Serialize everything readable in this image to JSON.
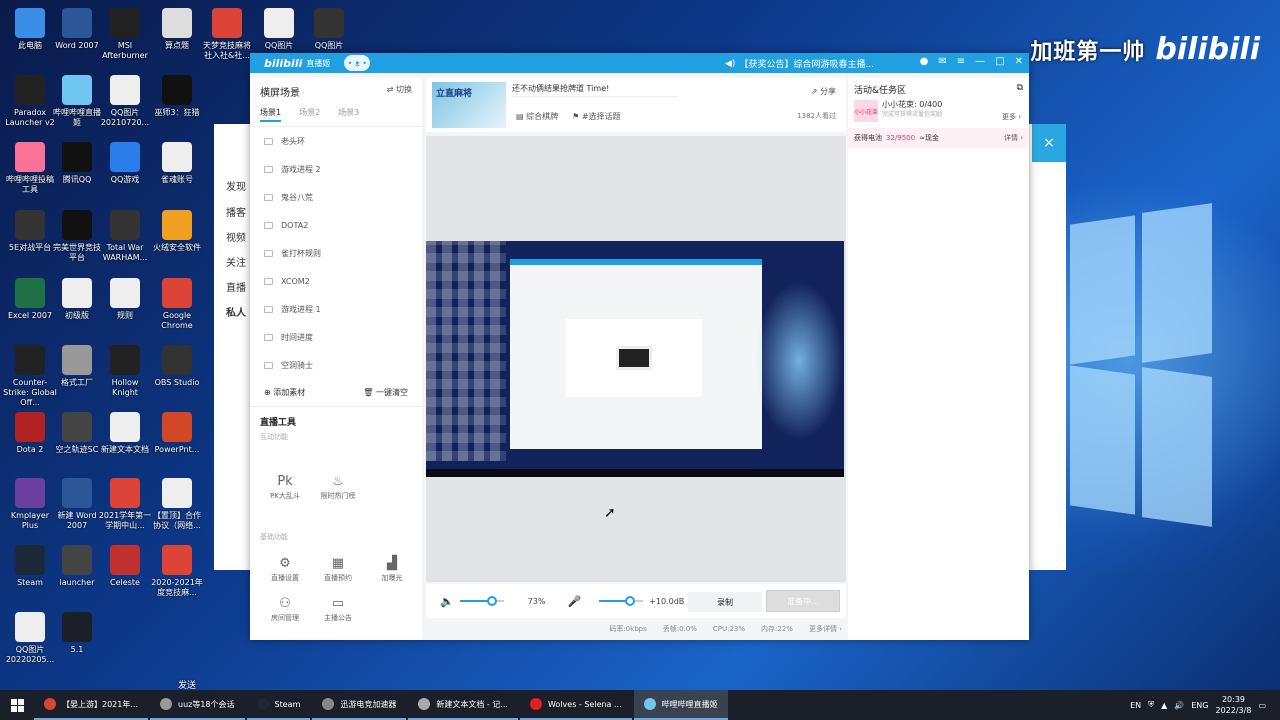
{
  "watermark": {
    "text": "加班第一帅",
    "logo": "bilibili"
  },
  "desktop_icons": [
    {
      "label": "此电脑",
      "color": "#3a8ee6"
    },
    {
      "label": "Word 2007",
      "color": "#2b5797"
    },
    {
      "label": "MSI Afterburner",
      "color": "#222"
    },
    {
      "label": "算点题",
      "color": "#ddd"
    },
    {
      "label": "天梦竞技麻将社入社&社...",
      "color": "#db4437"
    },
    {
      "label": "QQ图片",
      "color": "#eee"
    },
    {
      "label": "QQ图片",
      "color": "#333"
    },
    {
      "label": "Paradox Launcher v2",
      "color": "#222"
    },
    {
      "label": "哔哩哔哩直播姬",
      "color": "#6fc6f0"
    },
    {
      "label": "QQ图片 20210720...",
      "color": "#eee"
    },
    {
      "label": "巫师3：狂猎",
      "color": "#111"
    },
    {
      "label": "哔哩哔哩投稿工具",
      "color": "#fb7299"
    },
    {
      "label": "腾讯QQ",
      "color": "#111"
    },
    {
      "label": "QQ游戏",
      "color": "#2b7de9"
    },
    {
      "label": "雀魂账号",
      "color": "#eee"
    },
    {
      "label": "5E对战平台",
      "color": "#333"
    },
    {
      "label": "完美世界竞技平台",
      "color": "#111"
    },
    {
      "label": "Total War WARHAM...",
      "color": "#333"
    },
    {
      "label": "火绒安全软件",
      "color": "#f0a020"
    },
    {
      "label": "Excel 2007",
      "color": "#1e7145"
    },
    {
      "label": "初级版",
      "color": "#eee"
    },
    {
      "label": "规则",
      "color": "#eee"
    },
    {
      "label": "Google Chrome",
      "color": "#db4437"
    },
    {
      "label": "Counter-Strike: Global Off...",
      "color": "#222"
    },
    {
      "label": "格式工厂",
      "color": "#999"
    },
    {
      "label": "Hollow Knight",
      "color": "#222"
    },
    {
      "label": "OBS Studio",
      "color": "#333"
    },
    {
      "label": "Dota 2",
      "color": "#b22222"
    },
    {
      "label": "空之轨迹SC",
      "color": "#444"
    },
    {
      "label": "新建文本文档",
      "color": "#eee"
    },
    {
      "label": "PowerPnt...",
      "color": "#d24726"
    },
    {
      "label": "Kmplayer Plus",
      "color": "#6a3fa0"
    },
    {
      "label": "新建 Word 2007",
      "color": "#2b5797"
    },
    {
      "label": "2021学年第一学期中山...",
      "color": "#db4437"
    },
    {
      "label": "【置顶】合作协议（网络...",
      "color": "#eee"
    },
    {
      "label": "Steam",
      "color": "#1b2838"
    },
    {
      "label": "launcher",
      "color": "#444"
    },
    {
      "label": "Celeste",
      "color": "#c03030"
    },
    {
      "label": "2020-2021年度竞技麻...",
      "color": "#db4437"
    },
    {
      "label": "QQ图片 20220205...",
      "color": "#eee"
    },
    {
      "label": "5.1",
      "color": "#1b1f2a"
    }
  ],
  "back_window": {
    "items": [
      "发现",
      "播客",
      "视频",
      "关注",
      "直播",
      "私人"
    ],
    "close_icon": "×"
  },
  "app": {
    "brand": "bilibili",
    "brand_sub": "直播姬",
    "notice": "【获奖公告】综合网游吸春主播...",
    "scene_panel": {
      "title": "横屏场景",
      "switch_label": "切换",
      "tabs": [
        "场景1",
        "场景2",
        "场景3"
      ],
      "scenes": [
        "老头环",
        "游戏进程 2",
        "鬼谷八荒",
        "DOTA2",
        "雀打杯规则",
        "XCOM2",
        "游戏进程 1",
        "时间进度",
        "空洞骑士"
      ],
      "add_source": "添加素材",
      "clear_all": "一键清空"
    },
    "tools": {
      "title": "直播工具",
      "interactive_label": "互动功能",
      "interactive": [
        {
          "label": "PK大乱斗",
          "icon": "pk-icon"
        },
        {
          "label": "限时热门榜",
          "icon": "hot-icon"
        }
      ],
      "basic_label": "基础功能",
      "basic": [
        {
          "label": "直播设置",
          "icon": "gear-icon"
        },
        {
          "label": "直播预约",
          "icon": "calendar-icon"
        },
        {
          "label": "加曝光",
          "icon": "chart-icon"
        },
        {
          "label": "房间管理",
          "icon": "user-icon"
        },
        {
          "label": "主播公告",
          "icon": "notice-icon"
        }
      ]
    },
    "room": {
      "cover_text": "立直麻将",
      "title": "还不动俩结果抢牌道 Time!",
      "category": "综合棋牌",
      "tag": "#选择话题",
      "share": "分享",
      "viewers": "1382人看过"
    },
    "audio": {
      "volume": "73%",
      "volume_fraction": 0.73,
      "mic_level": "+10.0dB",
      "mic_fraction": 0.7,
      "record": "录制",
      "start": "准备中..."
    },
    "status": {
      "bitrate": "码率:0kbps",
      "drop": "丢帧:0.0%",
      "cpu": "CPU:23%",
      "memory": "内存:22%",
      "more": "更多详情"
    },
    "activity": {
      "title": "活动&任务区",
      "task_badge": "小小花束",
      "task_name": "小小花束: 0/400",
      "task_desc": "完成可获得流量包奖励",
      "more": "更多",
      "battery_label": "获得电池",
      "battery_value": "32/9500",
      "battery_note": "≈现金",
      "detail": "详情"
    }
  },
  "taskbar": {
    "items": [
      {
        "label": "【晏上游】2021年...",
        "color": "#db4437"
      },
      {
        "label": "uuz等18个会话",
        "color": "#999"
      },
      {
        "label": "Steam",
        "color": "#1b2838"
      },
      {
        "label": "迅游电竞加速器",
        "color": "#888"
      },
      {
        "label": "新建文本文档 - 记...",
        "color": "#aaa"
      },
      {
        "label": "Wolves - Selena ...",
        "color": "#e02020"
      },
      {
        "label": "哔哩哔哩直播姬",
        "color": "#6fc6f0"
      }
    ],
    "send_label": "发送",
    "lang": "ENG",
    "ime": "EN",
    "time": "20:39",
    "date": "2022/3/8"
  }
}
